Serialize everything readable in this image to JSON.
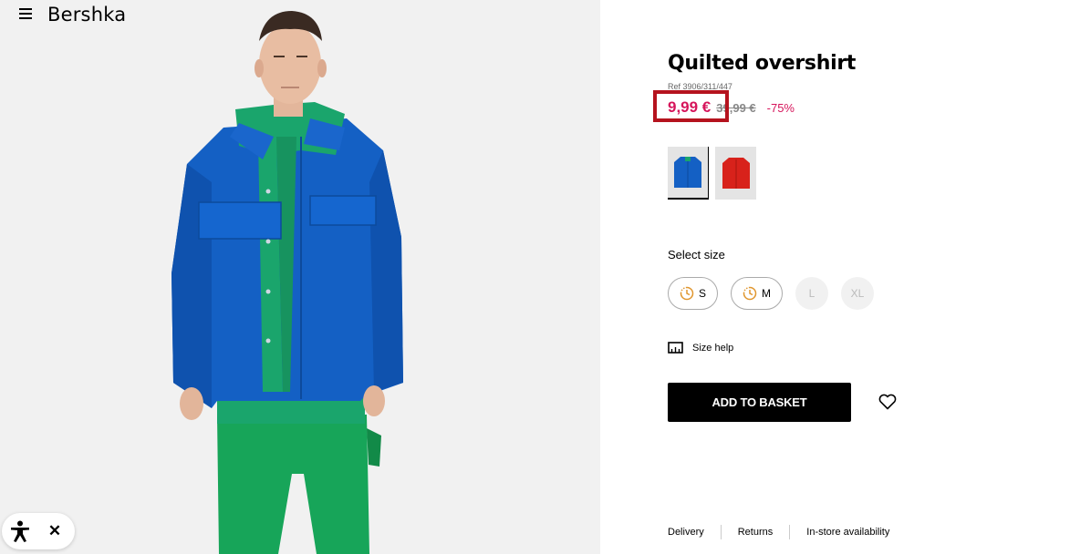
{
  "header": {
    "brand": "Bershka",
    "menu_icon": "hamburger-menu-icon"
  },
  "product": {
    "title": "Quilted overshirt",
    "ref": "Ref 3906/311/447",
    "price": "9,99 €",
    "old_price": "39,99 €",
    "discount": "-75%",
    "colors": [
      {
        "name": "blue",
        "hex": "#1460c4",
        "selected": true
      },
      {
        "name": "red",
        "hex": "#d8221b",
        "selected": false
      }
    ]
  },
  "size": {
    "label": "Select size",
    "options": [
      {
        "label": "S",
        "low_stock": true,
        "available": true
      },
      {
        "label": "M",
        "low_stock": true,
        "available": true
      },
      {
        "label": "L",
        "low_stock": false,
        "available": false
      },
      {
        "label": "XL",
        "low_stock": false,
        "available": false
      }
    ],
    "help_label": "Size help"
  },
  "actions": {
    "add_to_basket": "ADD TO BASKET"
  },
  "footer": {
    "delivery": "Delivery",
    "returns": "Returns",
    "instore": "In-store availability"
  },
  "colors": {
    "price_accent": "#d6155b",
    "highlight": "#b5131e",
    "jacket": "#1460c4",
    "hoodie": "#1aa56c"
  }
}
